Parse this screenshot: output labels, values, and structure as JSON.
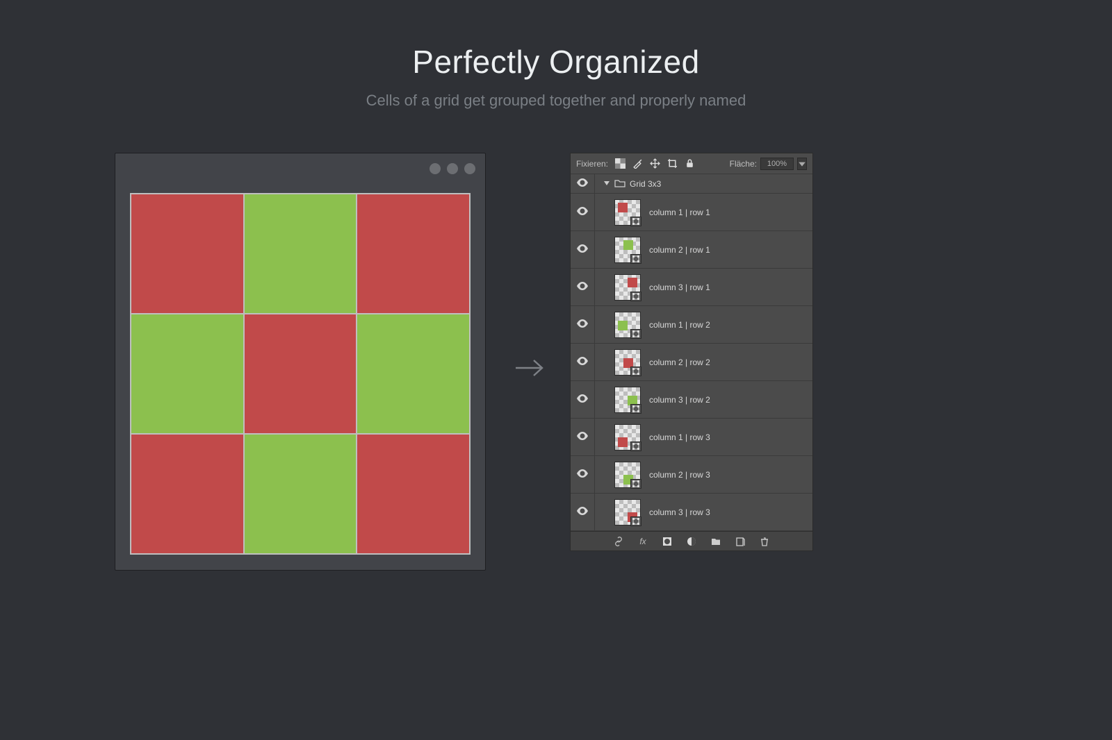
{
  "heading": {
    "title": "Perfectly Organized",
    "subtitle": "Cells of a grid get grouped together and properly named"
  },
  "grid": {
    "cells": [
      [
        "red",
        "green",
        "red"
      ],
      [
        "green",
        "red",
        "green"
      ],
      [
        "red",
        "green",
        "red"
      ]
    ]
  },
  "panel": {
    "lock_label": "Fixieren:",
    "fill_label": "Fläche:",
    "fill_value": "100%",
    "group_name": "Grid 3x3",
    "toolbar_icons": [
      "checkerboard-icon",
      "brush-icon",
      "move-icon",
      "crop-icon",
      "lock-icon"
    ],
    "layers": [
      {
        "name": "column 1 | row 1",
        "color": "red",
        "pos": "tl"
      },
      {
        "name": "column 2 | row 1",
        "color": "green",
        "pos": "tc"
      },
      {
        "name": "column 3 | row 1",
        "color": "red",
        "pos": "tr"
      },
      {
        "name": "column 1 | row 2",
        "color": "green",
        "pos": "ml"
      },
      {
        "name": "column 2 | row 2",
        "color": "red",
        "pos": "mc"
      },
      {
        "name": "column 3 | row 2",
        "color": "green",
        "pos": "mr"
      },
      {
        "name": "column 1 | row 3",
        "color": "red",
        "pos": "bl"
      },
      {
        "name": "column 2 | row 3",
        "color": "green",
        "pos": "bc"
      },
      {
        "name": "column 3 | row 3",
        "color": "red",
        "pos": "br"
      }
    ],
    "footer_icons": [
      "link-icon",
      "fx-icon",
      "mask-icon",
      "adjust-icon",
      "folder-icon",
      "new-layer-icon",
      "trash-icon"
    ]
  }
}
